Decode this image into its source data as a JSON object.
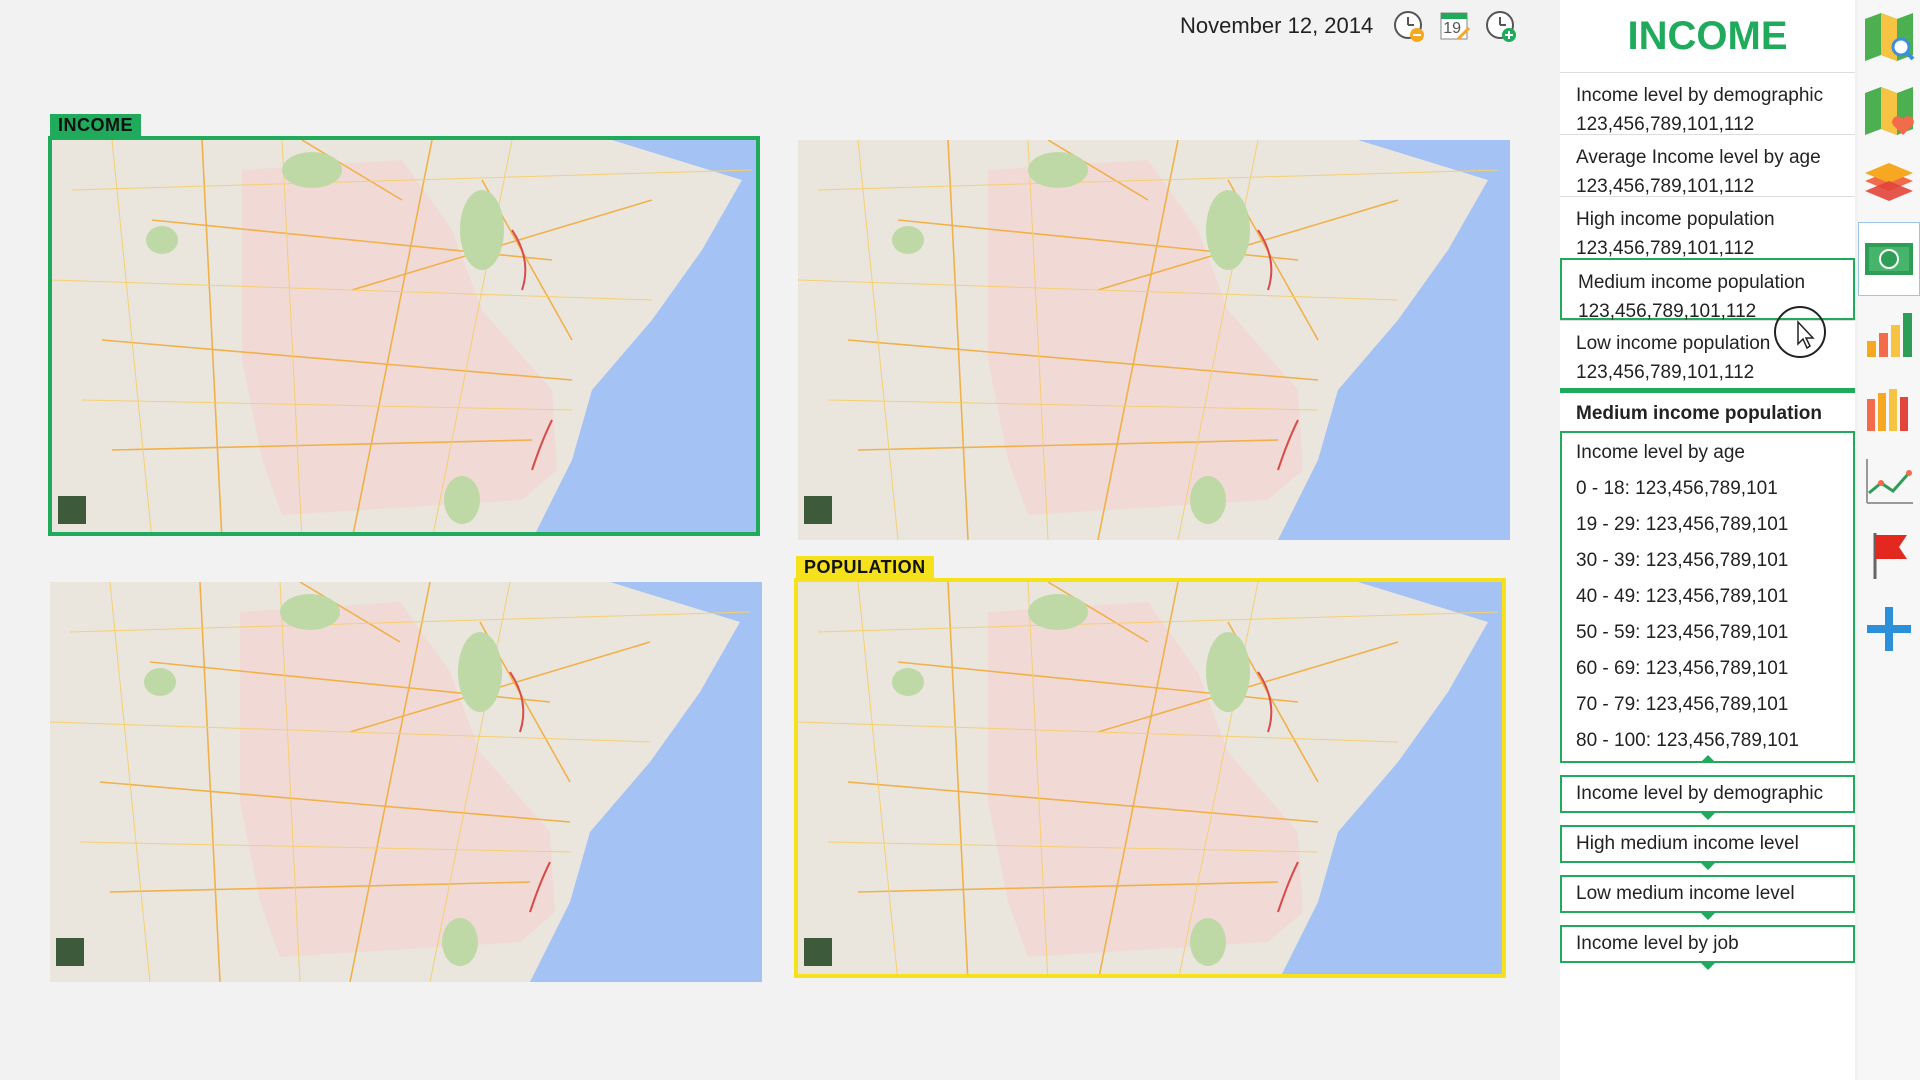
{
  "header": {
    "date": "November 12, 2014",
    "calendar_day": "19"
  },
  "maps": {
    "top_left_label": "INCOME",
    "bottom_right_label": "POPULATION"
  },
  "sidebar": {
    "title": "INCOME",
    "metrics": [
      {
        "label": "Income level by demographic",
        "value": "123,456,789,101,112"
      },
      {
        "label": "Average Income level by age",
        "value": "123,456,789,101,112"
      },
      {
        "label": "High income population",
        "value": "123,456,789,101,112"
      },
      {
        "label": "Medium income population",
        "value": "123,456,789,101,112"
      },
      {
        "label": "Low income population",
        "value": "123,456,789,101,112"
      }
    ],
    "detail_title": "Medium income population",
    "detail_heading": "Income level by age",
    "age_rows": [
      "0 - 18: 123,456,789,101",
      "19 - 29: 123,456,789,101",
      "30 - 39: 123,456,789,101",
      "40 - 49: 123,456,789,101",
      "50 - 59: 123,456,789,101",
      "60 - 69: 123,456,789,101",
      "70 - 79: 123,456,789,101",
      "80 - 100: 123,456,789,101"
    ],
    "accordions": [
      "Income level by demographic",
      "High medium income level",
      "Low medium income level",
      "Income level by job"
    ]
  },
  "rail": [
    "map-search-icon",
    "map-favorite-icon",
    "layers-icon",
    "money-icon",
    "bar-chart-icon",
    "stacked-bar-chart-icon",
    "line-chart-icon",
    "flag-icon",
    "add-icon"
  ],
  "colors": {
    "accent_green": "#1faa5c",
    "population_yellow": "#f5e11c",
    "water": "#a4c2f4"
  }
}
